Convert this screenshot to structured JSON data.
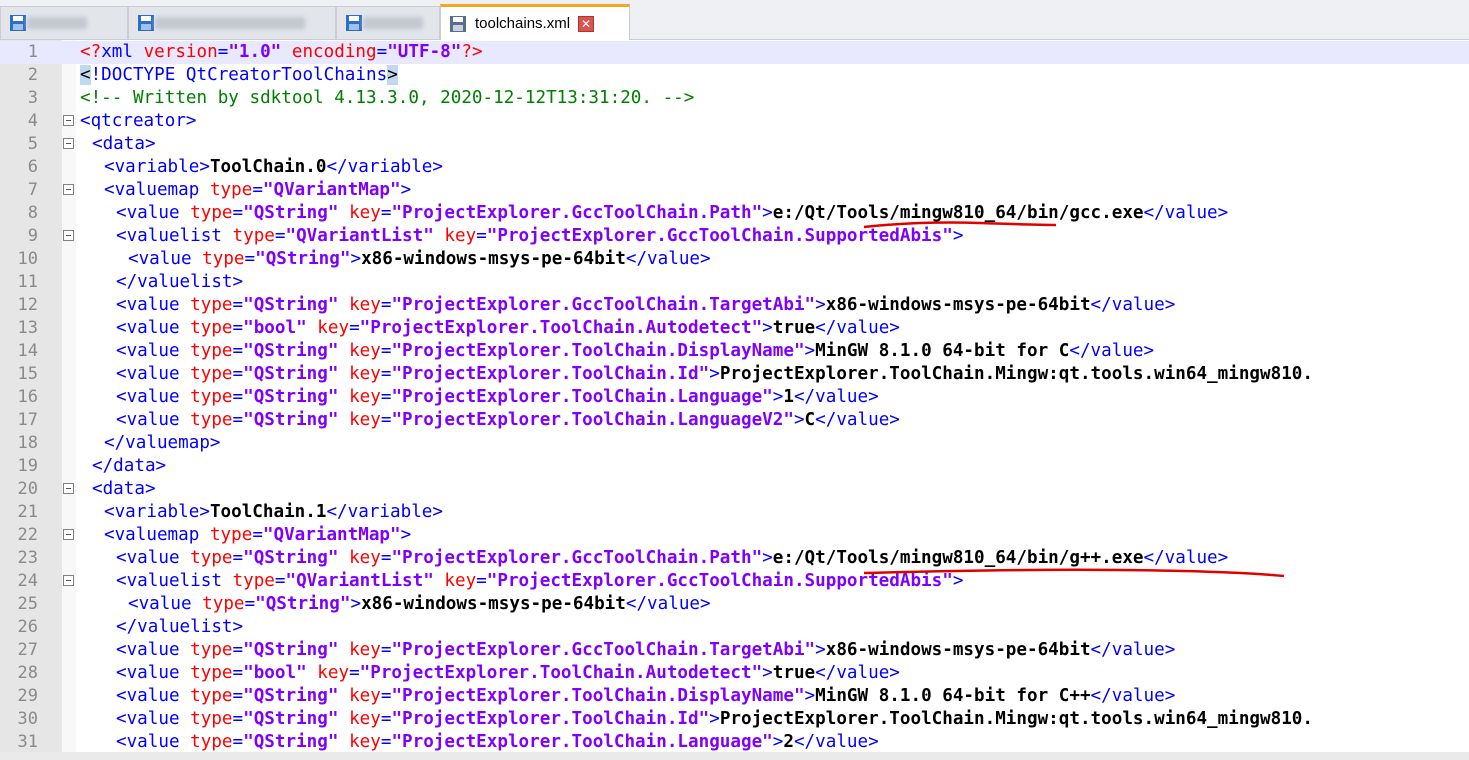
{
  "tabs": [
    {
      "label": "",
      "active": false
    },
    {
      "label": "",
      "active": false
    },
    {
      "label": "",
      "active": false
    },
    {
      "label": "toolchains.xml",
      "active": true
    }
  ],
  "colors": {
    "tag": "#0000ff",
    "attr": "#ff0000",
    "value": "#8000ff",
    "text": "#000000",
    "comment": "#008000",
    "annotation": "#e00000"
  },
  "editor": {
    "current_line": 1,
    "lines": [
      {
        "n": "1",
        "indent": 0,
        "fold": false,
        "tokens": [
          {
            "k": "pi",
            "t": "<?"
          },
          {
            "k": "t",
            "t": "xml"
          },
          {
            "k": "s",
            "t": " "
          },
          {
            "k": "a",
            "t": "version"
          },
          {
            "k": "t",
            "t": "="
          },
          {
            "k": "v",
            "t": "\"1.0\""
          },
          {
            "k": "s",
            "t": " "
          },
          {
            "k": "a",
            "t": "encoding"
          },
          {
            "k": "t",
            "t": "="
          },
          {
            "k": "v",
            "t": "\"UTF-8\""
          },
          {
            "k": "pi",
            "t": "?>"
          }
        ]
      },
      {
        "n": "2",
        "indent": 0,
        "fold": false,
        "tokens": [
          {
            "k": "hl",
            "t": "<"
          },
          {
            "k": "t",
            "t": "!DOCTYPE QtCreatorToolChains"
          },
          {
            "k": "hl",
            "t": ">"
          }
        ]
      },
      {
        "n": "3",
        "indent": 0,
        "fold": false,
        "tokens": [
          {
            "k": "c",
            "t": "<!-- Written by sdktool 4.13.3.0, 2020-12-12T13:31:20. -->"
          }
        ]
      },
      {
        "n": "4",
        "indent": 0,
        "fold": true,
        "tokens": [
          {
            "k": "t",
            "t": "<qtcreator>"
          }
        ]
      },
      {
        "n": "5",
        "indent": 1,
        "fold": true,
        "tokens": [
          {
            "k": "t",
            "t": "<data>"
          }
        ]
      },
      {
        "n": "6",
        "indent": 2,
        "fold": false,
        "tokens": [
          {
            "k": "t",
            "t": "<variable>"
          },
          {
            "k": "x",
            "t": "ToolChain.0"
          },
          {
            "k": "t",
            "t": "</variable>"
          }
        ]
      },
      {
        "n": "7",
        "indent": 2,
        "fold": true,
        "tokens": [
          {
            "k": "t",
            "t": "<valuemap "
          },
          {
            "k": "a",
            "t": "type"
          },
          {
            "k": "t",
            "t": "="
          },
          {
            "k": "v",
            "t": "\"QVariantMap\""
          },
          {
            "k": "t",
            "t": ">"
          }
        ]
      },
      {
        "n": "8",
        "indent": 3,
        "fold": false,
        "tokens": [
          {
            "k": "t",
            "t": "<value "
          },
          {
            "k": "a",
            "t": "type"
          },
          {
            "k": "t",
            "t": "="
          },
          {
            "k": "v",
            "t": "\"QString\""
          },
          {
            "k": "s",
            "t": " "
          },
          {
            "k": "a",
            "t": "key"
          },
          {
            "k": "t",
            "t": "="
          },
          {
            "k": "v",
            "t": "\"ProjectExplorer.GccToolChain.Path\""
          },
          {
            "k": "t",
            "t": ">"
          },
          {
            "k": "x",
            "t": "e:/Qt/Tools/mingw810_64/bin/gcc.exe"
          },
          {
            "k": "t",
            "t": "</value>"
          }
        ]
      },
      {
        "n": "9",
        "indent": 3,
        "fold": true,
        "tokens": [
          {
            "k": "t",
            "t": "<valuelist "
          },
          {
            "k": "a",
            "t": "type"
          },
          {
            "k": "t",
            "t": "="
          },
          {
            "k": "v",
            "t": "\"QVariantList\""
          },
          {
            "k": "s",
            "t": " "
          },
          {
            "k": "a",
            "t": "key"
          },
          {
            "k": "t",
            "t": "="
          },
          {
            "k": "v",
            "t": "\"ProjectExplorer.GccToolChain.SupportedAbis\""
          },
          {
            "k": "t",
            "t": ">"
          }
        ]
      },
      {
        "n": "10",
        "indent": 4,
        "fold": false,
        "tokens": [
          {
            "k": "t",
            "t": "<value "
          },
          {
            "k": "a",
            "t": "type"
          },
          {
            "k": "t",
            "t": "="
          },
          {
            "k": "v",
            "t": "\"QString\""
          },
          {
            "k": "t",
            "t": ">"
          },
          {
            "k": "x",
            "t": "x86-windows-msys-pe-64bit"
          },
          {
            "k": "t",
            "t": "</value>"
          }
        ]
      },
      {
        "n": "11",
        "indent": 3,
        "fold": false,
        "tokens": [
          {
            "k": "t",
            "t": "</valuelist>"
          }
        ]
      },
      {
        "n": "12",
        "indent": 3,
        "fold": false,
        "tokens": [
          {
            "k": "t",
            "t": "<value "
          },
          {
            "k": "a",
            "t": "type"
          },
          {
            "k": "t",
            "t": "="
          },
          {
            "k": "v",
            "t": "\"QString\""
          },
          {
            "k": "s",
            "t": " "
          },
          {
            "k": "a",
            "t": "key"
          },
          {
            "k": "t",
            "t": "="
          },
          {
            "k": "v",
            "t": "\"ProjectExplorer.GccToolChain.TargetAbi\""
          },
          {
            "k": "t",
            "t": ">"
          },
          {
            "k": "x",
            "t": "x86-windows-msys-pe-64bit"
          },
          {
            "k": "t",
            "t": "</value>"
          }
        ]
      },
      {
        "n": "13",
        "indent": 3,
        "fold": false,
        "tokens": [
          {
            "k": "t",
            "t": "<value "
          },
          {
            "k": "a",
            "t": "type"
          },
          {
            "k": "t",
            "t": "="
          },
          {
            "k": "v",
            "t": "\"bool\""
          },
          {
            "k": "s",
            "t": " "
          },
          {
            "k": "a",
            "t": "key"
          },
          {
            "k": "t",
            "t": "="
          },
          {
            "k": "v",
            "t": "\"ProjectExplorer.ToolChain.Autodetect\""
          },
          {
            "k": "t",
            "t": ">"
          },
          {
            "k": "x",
            "t": "true"
          },
          {
            "k": "t",
            "t": "</value>"
          }
        ]
      },
      {
        "n": "14",
        "indent": 3,
        "fold": false,
        "tokens": [
          {
            "k": "t",
            "t": "<value "
          },
          {
            "k": "a",
            "t": "type"
          },
          {
            "k": "t",
            "t": "="
          },
          {
            "k": "v",
            "t": "\"QString\""
          },
          {
            "k": "s",
            "t": " "
          },
          {
            "k": "a",
            "t": "key"
          },
          {
            "k": "t",
            "t": "="
          },
          {
            "k": "v",
            "t": "\"ProjectExplorer.ToolChain.DisplayName\""
          },
          {
            "k": "t",
            "t": ">"
          },
          {
            "k": "x",
            "t": "MinGW 8.1.0 64-bit for C"
          },
          {
            "k": "t",
            "t": "</value>"
          }
        ]
      },
      {
        "n": "15",
        "indent": 3,
        "fold": false,
        "tokens": [
          {
            "k": "t",
            "t": "<value "
          },
          {
            "k": "a",
            "t": "type"
          },
          {
            "k": "t",
            "t": "="
          },
          {
            "k": "v",
            "t": "\"QString\""
          },
          {
            "k": "s",
            "t": " "
          },
          {
            "k": "a",
            "t": "key"
          },
          {
            "k": "t",
            "t": "="
          },
          {
            "k": "v",
            "t": "\"ProjectExplorer.ToolChain.Id\""
          },
          {
            "k": "t",
            "t": ">"
          },
          {
            "k": "x",
            "t": "ProjectExplorer.ToolChain.Mingw:qt.tools.win64_mingw810."
          }
        ]
      },
      {
        "n": "16",
        "indent": 3,
        "fold": false,
        "tokens": [
          {
            "k": "t",
            "t": "<value "
          },
          {
            "k": "a",
            "t": "type"
          },
          {
            "k": "t",
            "t": "="
          },
          {
            "k": "v",
            "t": "\"QString\""
          },
          {
            "k": "s",
            "t": " "
          },
          {
            "k": "a",
            "t": "key"
          },
          {
            "k": "t",
            "t": "="
          },
          {
            "k": "v",
            "t": "\"ProjectExplorer.ToolChain.Language\""
          },
          {
            "k": "t",
            "t": ">"
          },
          {
            "k": "x",
            "t": "1"
          },
          {
            "k": "t",
            "t": "</value>"
          }
        ]
      },
      {
        "n": "17",
        "indent": 3,
        "fold": false,
        "tokens": [
          {
            "k": "t",
            "t": "<value "
          },
          {
            "k": "a",
            "t": "type"
          },
          {
            "k": "t",
            "t": "="
          },
          {
            "k": "v",
            "t": "\"QString\""
          },
          {
            "k": "s",
            "t": " "
          },
          {
            "k": "a",
            "t": "key"
          },
          {
            "k": "t",
            "t": "="
          },
          {
            "k": "v",
            "t": "\"ProjectExplorer.ToolChain.LanguageV2\""
          },
          {
            "k": "t",
            "t": ">"
          },
          {
            "k": "x",
            "t": "C"
          },
          {
            "k": "t",
            "t": "</value>"
          }
        ]
      },
      {
        "n": "18",
        "indent": 2,
        "fold": false,
        "tokens": [
          {
            "k": "t",
            "t": "</valuemap>"
          }
        ]
      },
      {
        "n": "19",
        "indent": 1,
        "fold": false,
        "tokens": [
          {
            "k": "t",
            "t": "</data>"
          }
        ]
      },
      {
        "n": "20",
        "indent": 1,
        "fold": true,
        "tokens": [
          {
            "k": "t",
            "t": "<data>"
          }
        ]
      },
      {
        "n": "21",
        "indent": 2,
        "fold": false,
        "tokens": [
          {
            "k": "t",
            "t": "<variable>"
          },
          {
            "k": "x",
            "t": "ToolChain.1"
          },
          {
            "k": "t",
            "t": "</variable>"
          }
        ]
      },
      {
        "n": "22",
        "indent": 2,
        "fold": true,
        "tokens": [
          {
            "k": "t",
            "t": "<valuemap "
          },
          {
            "k": "a",
            "t": "type"
          },
          {
            "k": "t",
            "t": "="
          },
          {
            "k": "v",
            "t": "\"QVariantMap\""
          },
          {
            "k": "t",
            "t": ">"
          }
        ]
      },
      {
        "n": "23",
        "indent": 3,
        "fold": false,
        "tokens": [
          {
            "k": "t",
            "t": "<value "
          },
          {
            "k": "a",
            "t": "type"
          },
          {
            "k": "t",
            "t": "="
          },
          {
            "k": "v",
            "t": "\"QString\""
          },
          {
            "k": "s",
            "t": " "
          },
          {
            "k": "a",
            "t": "key"
          },
          {
            "k": "t",
            "t": "="
          },
          {
            "k": "v",
            "t": "\"ProjectExplorer.GccToolChain.Path\""
          },
          {
            "k": "t",
            "t": ">"
          },
          {
            "k": "x",
            "t": "e:/Qt/Tools/mingw810_64/bin/g++.exe"
          },
          {
            "k": "t",
            "t": "</value>"
          }
        ]
      },
      {
        "n": "24",
        "indent": 3,
        "fold": true,
        "tokens": [
          {
            "k": "t",
            "t": "<valuelist "
          },
          {
            "k": "a",
            "t": "type"
          },
          {
            "k": "t",
            "t": "="
          },
          {
            "k": "v",
            "t": "\"QVariantList\""
          },
          {
            "k": "s",
            "t": " "
          },
          {
            "k": "a",
            "t": "key"
          },
          {
            "k": "t",
            "t": "="
          },
          {
            "k": "v",
            "t": "\"ProjectExplorer.GccToolChain.SupportedAbis\""
          },
          {
            "k": "t",
            "t": ">"
          }
        ]
      },
      {
        "n": "25",
        "indent": 4,
        "fold": false,
        "tokens": [
          {
            "k": "t",
            "t": "<value "
          },
          {
            "k": "a",
            "t": "type"
          },
          {
            "k": "t",
            "t": "="
          },
          {
            "k": "v",
            "t": "\"QString\""
          },
          {
            "k": "t",
            "t": ">"
          },
          {
            "k": "x",
            "t": "x86-windows-msys-pe-64bit"
          },
          {
            "k": "t",
            "t": "</value>"
          }
        ]
      },
      {
        "n": "26",
        "indent": 3,
        "fold": false,
        "tokens": [
          {
            "k": "t",
            "t": "</valuelist>"
          }
        ]
      },
      {
        "n": "27",
        "indent": 3,
        "fold": false,
        "tokens": [
          {
            "k": "t",
            "t": "<value "
          },
          {
            "k": "a",
            "t": "type"
          },
          {
            "k": "t",
            "t": "="
          },
          {
            "k": "v",
            "t": "\"QString\""
          },
          {
            "k": "s",
            "t": " "
          },
          {
            "k": "a",
            "t": "key"
          },
          {
            "k": "t",
            "t": "="
          },
          {
            "k": "v",
            "t": "\"ProjectExplorer.GccToolChain.TargetAbi\""
          },
          {
            "k": "t",
            "t": ">"
          },
          {
            "k": "x",
            "t": "x86-windows-msys-pe-64bit"
          },
          {
            "k": "t",
            "t": "</value>"
          }
        ]
      },
      {
        "n": "28",
        "indent": 3,
        "fold": false,
        "tokens": [
          {
            "k": "t",
            "t": "<value "
          },
          {
            "k": "a",
            "t": "type"
          },
          {
            "k": "t",
            "t": "="
          },
          {
            "k": "v",
            "t": "\"bool\""
          },
          {
            "k": "s",
            "t": " "
          },
          {
            "k": "a",
            "t": "key"
          },
          {
            "k": "t",
            "t": "="
          },
          {
            "k": "v",
            "t": "\"ProjectExplorer.ToolChain.Autodetect\""
          },
          {
            "k": "t",
            "t": ">"
          },
          {
            "k": "x",
            "t": "true"
          },
          {
            "k": "t",
            "t": "</value>"
          }
        ]
      },
      {
        "n": "29",
        "indent": 3,
        "fold": false,
        "tokens": [
          {
            "k": "t",
            "t": "<value "
          },
          {
            "k": "a",
            "t": "type"
          },
          {
            "k": "t",
            "t": "="
          },
          {
            "k": "v",
            "t": "\"QString\""
          },
          {
            "k": "s",
            "t": " "
          },
          {
            "k": "a",
            "t": "key"
          },
          {
            "k": "t",
            "t": "="
          },
          {
            "k": "v",
            "t": "\"ProjectExplorer.ToolChain.DisplayName\""
          },
          {
            "k": "t",
            "t": ">"
          },
          {
            "k": "x",
            "t": "MinGW 8.1.0 64-bit for C++"
          },
          {
            "k": "t",
            "t": "</value>"
          }
        ]
      },
      {
        "n": "30",
        "indent": 3,
        "fold": false,
        "tokens": [
          {
            "k": "t",
            "t": "<value "
          },
          {
            "k": "a",
            "t": "type"
          },
          {
            "k": "t",
            "t": "="
          },
          {
            "k": "v",
            "t": "\"QString\""
          },
          {
            "k": "s",
            "t": " "
          },
          {
            "k": "a",
            "t": "key"
          },
          {
            "k": "t",
            "t": "="
          },
          {
            "k": "v",
            "t": "\"ProjectExplorer.ToolChain.Id\""
          },
          {
            "k": "t",
            "t": ">"
          },
          {
            "k": "x",
            "t": "ProjectExplorer.ToolChain.Mingw:qt.tools.win64_mingw810."
          }
        ]
      },
      {
        "n": "31",
        "indent": 3,
        "fold": false,
        "tokens": [
          {
            "k": "t",
            "t": "<value "
          },
          {
            "k": "a",
            "t": "type"
          },
          {
            "k": "t",
            "t": "="
          },
          {
            "k": "v",
            "t": "\"QString\""
          },
          {
            "k": "s",
            "t": " "
          },
          {
            "k": "a",
            "t": "key"
          },
          {
            "k": "t",
            "t": "="
          },
          {
            "k": "v",
            "t": "\"ProjectExplorer.ToolChain.Language\""
          },
          {
            "k": "t",
            "t": ">"
          },
          {
            "k": "x",
            "t": "2"
          },
          {
            "k": "t",
            "t": "</value>"
          }
        ]
      }
    ]
  }
}
